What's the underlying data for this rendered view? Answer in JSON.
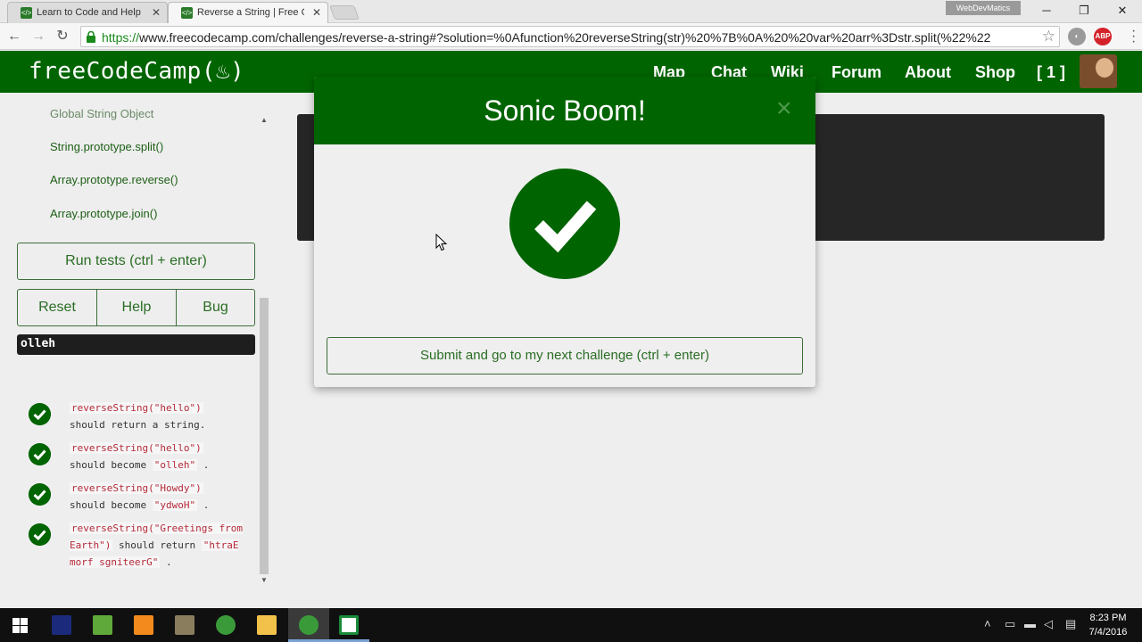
{
  "browser": {
    "tabs": [
      {
        "title": "Learn to Code and Help N",
        "active": false
      },
      {
        "title": "Reverse a String | Free Co",
        "active": true
      }
    ],
    "profile_label": "WebDevMatics",
    "url_protocol": "https://",
    "url_rest": "www.freecodecamp.com/challenges/reverse-a-string#?solution=%0Afunction%20reverseString(str)%20%7B%0A%20%20var%20arr%3Dstr.split(%22%22",
    "ext_abp": "ABP"
  },
  "site": {
    "logo": "freeCodeCamp(🔥)",
    "logo_text": "freeCodeCamp(",
    "logo_flame": "♨",
    "logo_close": ")",
    "nav": [
      "Map",
      "Chat",
      "Wiki",
      "Forum",
      "About",
      "Shop",
      "[ 1 ]"
    ],
    "brand_color": "#006400"
  },
  "sidebar": {
    "references": [
      "Global String Object",
      "String.prototype.split()",
      "Array.prototype.reverse()",
      "Array.prototype.join()"
    ],
    "run_tests": "Run tests (ctrl + enter)",
    "reset": "Reset",
    "help": "Help",
    "bug": "Bug",
    "output": "olleh",
    "tests": [
      {
        "code": "reverseString(\"hello\")",
        "text": "should return a string",
        "code2": "",
        "end": "."
      },
      {
        "code": "reverseString(\"hello\")",
        "text": "should become",
        "code2": "\"olleh\"",
        "end": "."
      },
      {
        "code": "reverseString(\"Howdy\")",
        "text": "should become",
        "code2": "\"ydwoH\"",
        "end": "."
      },
      {
        "code": "reverseString(\"Greetings from Earth\")",
        "text": "should return",
        "code2": "\"htraE morf sgniteerG\"",
        "end": "."
      }
    ]
  },
  "modal": {
    "title": "Sonic Boom!",
    "close": "×",
    "submit": "Submit and go to my next challenge (ctrl + enter)"
  },
  "taskbar": {
    "time": "8:23 PM",
    "date": "7/4/2016"
  }
}
